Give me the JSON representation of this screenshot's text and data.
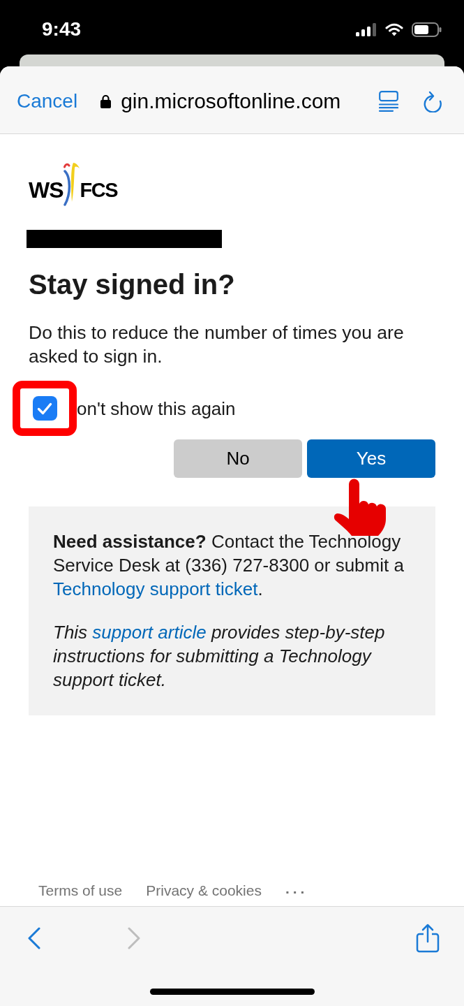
{
  "status_bar": {
    "time": "9:43"
  },
  "browser_bar": {
    "cancel": "Cancel",
    "url": "gin.microsoftonline.com"
  },
  "logo": {
    "left": "WS",
    "right": "FCS"
  },
  "title": "Stay signed in?",
  "description": "Do this to reduce the number of times you are asked to sign in.",
  "checkbox": {
    "label": "on't show this again",
    "checked": true,
    "highlighted": true
  },
  "buttons": [
    {
      "label": "No",
      "kind": "secondary"
    },
    {
      "label": "Yes",
      "kind": "primary"
    }
  ],
  "assistance": {
    "paragraphs": [
      {
        "italic": false,
        "parts": [
          {
            "kind": "bold",
            "text": "Need assistance?"
          },
          {
            "kind": "plain",
            "text": " Contact the Technology Service Desk at (336) 727-8300 or submit a "
          },
          {
            "kind": "link",
            "text": "Technology support ticket"
          },
          {
            "kind": "plain",
            "text": "."
          }
        ]
      },
      {
        "italic": true,
        "parts": [
          {
            "kind": "plain",
            "text": "This "
          },
          {
            "kind": "link",
            "text": "support article"
          },
          {
            "kind": "plain",
            "text": " provides step-by-step instructions for submitting a Technology support ticket."
          }
        ]
      }
    ]
  },
  "footer": {
    "links": [
      "Terms of use",
      "Privacy & cookies"
    ],
    "more": "..."
  },
  "toolbar": {
    "back": {
      "disabled": false
    },
    "forward": {
      "disabled": true
    }
  }
}
